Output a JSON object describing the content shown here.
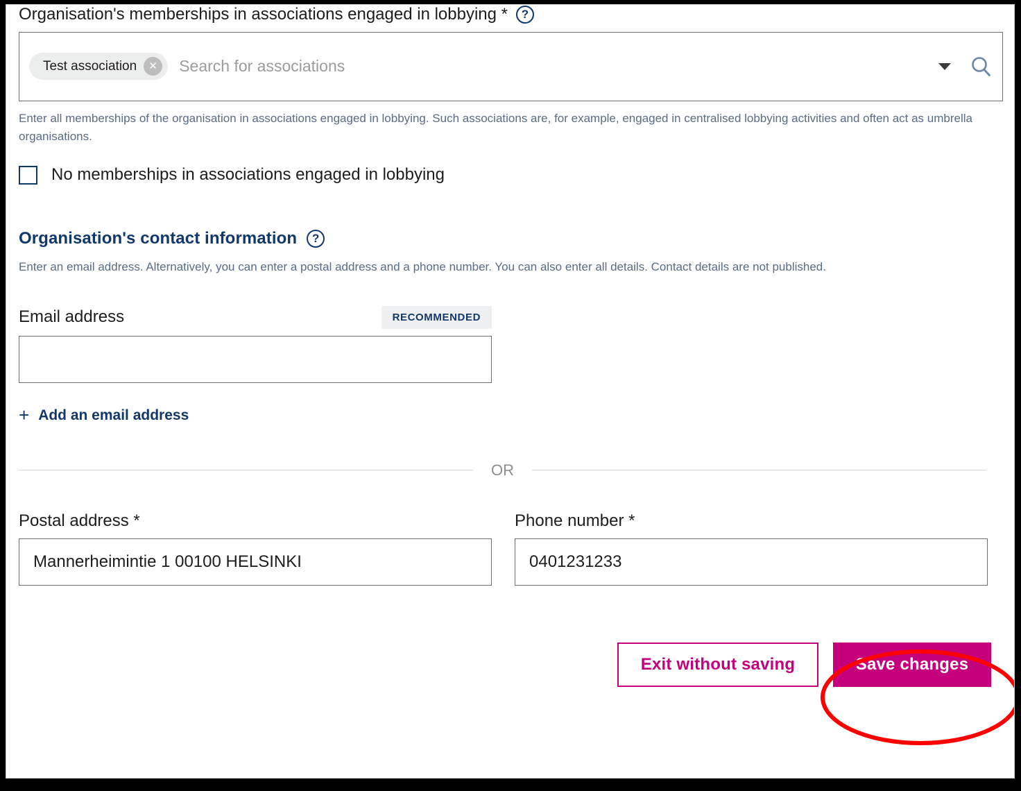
{
  "memberships": {
    "label": "Organisation's memberships in associations engaged in lobbying *",
    "help_icon": "help-circle-icon",
    "chip": {
      "label": "Test association",
      "remove_icon": "close-icon"
    },
    "search_placeholder": "Search for associations",
    "caret_icon": "chevron-down-icon",
    "search_icon": "search-icon",
    "helper_text": "Enter all memberships of the organisation in associations engaged in lobbying. Such associations are, for example, engaged in centralised lobbying activities and often act as umbrella organisations.",
    "no_memberships_label": "No memberships in associations engaged in lobbying",
    "no_memberships_checked": false
  },
  "contact": {
    "title": "Organisation's contact information",
    "help_icon": "help-circle-icon",
    "helper_text": "Enter an email address. Alternatively, you can enter a postal address and a phone number. You can also enter all details. Contact details are not published.",
    "email": {
      "label": "Email address",
      "badge": "RECOMMENDED",
      "value": "",
      "placeholder": ""
    },
    "add_email_label": "Add an email address",
    "add_email_icon": "plus-icon",
    "or_label": "OR",
    "postal": {
      "label": "Postal address *",
      "value": "Mannerheimintie 1 00100 HELSINKI"
    },
    "phone": {
      "label": "Phone number *",
      "value": "0401231233"
    }
  },
  "actions": {
    "exit_label": "Exit without saving",
    "save_label": "Save changes"
  },
  "annotation": {
    "shape": "ellipse-highlight",
    "color": "#FF0000",
    "target": "Save changes"
  },
  "colors": {
    "navy": "#11386B",
    "magenta": "#C5007C",
    "annotation_red": "#FF0000",
    "helper_gray": "#5A6B82",
    "chip_bg": "#ECEDED",
    "badge_bg": "#EFF0F1"
  }
}
